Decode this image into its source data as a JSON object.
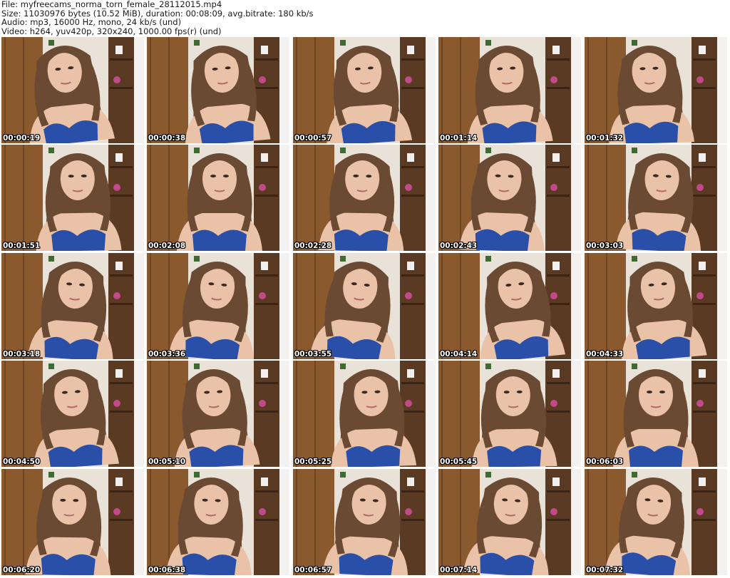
{
  "header": {
    "file_line": "File: myfreecams_norma_torn_female_28112015.mp4",
    "size_line": "Size: 11030976 bytes (10.52 MiB), duration: 00:08:09, avg.bitrate: 180 kb/s",
    "audio_line": "Audio: mp3, 16000 Hz, mono, 24 kb/s (und)",
    "video_line": "Video: h264, yuv420p, 320x240, 1000.00 fps(r) (und)"
  },
  "thumbnails": [
    {
      "timestamp": "00:00:19"
    },
    {
      "timestamp": "00:00:38"
    },
    {
      "timestamp": "00:00:57"
    },
    {
      "timestamp": "00:01:14"
    },
    {
      "timestamp": "00:01:32"
    },
    {
      "timestamp": "00:01:51"
    },
    {
      "timestamp": "00:02:08"
    },
    {
      "timestamp": "00:02:28"
    },
    {
      "timestamp": "00:02:43"
    },
    {
      "timestamp": "00:03:03"
    },
    {
      "timestamp": "00:03:18"
    },
    {
      "timestamp": "00:03:36"
    },
    {
      "timestamp": "00:03:55"
    },
    {
      "timestamp": "00:04:14"
    },
    {
      "timestamp": "00:04:33"
    },
    {
      "timestamp": "00:04:50"
    },
    {
      "timestamp": "00:05:10"
    },
    {
      "timestamp": "00:05:25"
    },
    {
      "timestamp": "00:05:45"
    },
    {
      "timestamp": "00:06:03"
    },
    {
      "timestamp": "00:06:20"
    },
    {
      "timestamp": "00:06:38"
    },
    {
      "timestamp": "00:06:57"
    },
    {
      "timestamp": "00:07:14"
    },
    {
      "timestamp": "00:07:32"
    }
  ],
  "colors": {
    "background": "#ffffff",
    "wood": "#8a5a2e",
    "wall": "#e9e2d8",
    "skin": "#e9c2a8",
    "hair": "#6b4a33",
    "bra": "#2a4fa8"
  }
}
